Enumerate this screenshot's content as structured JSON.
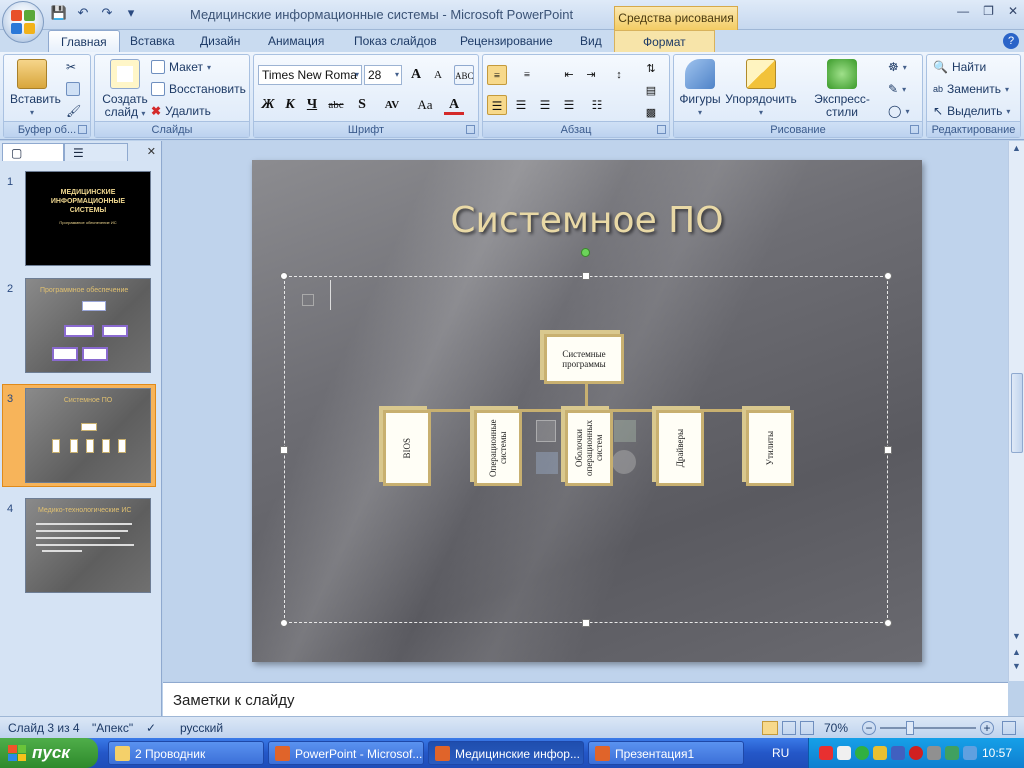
{
  "window": {
    "title": "Медицинские информационные системы - Microsoft PowerPoint",
    "context_tab": "Средства рисования"
  },
  "tabs": [
    "Главная",
    "Вставка",
    "Дизайн",
    "Анимация",
    "Показ слайдов",
    "Рецензирование",
    "Вид",
    "Формат"
  ],
  "ribbon": {
    "clipboard": {
      "paste": "Вставить",
      "label": "Буфер об..."
    },
    "slides": {
      "new_slide_1": "Создать",
      "new_slide_2": "слайд",
      "layout": "Макет",
      "reset": "Восстановить",
      "delete": "Удалить",
      "label": "Слайды"
    },
    "font": {
      "name": "Times New Roma",
      "size": "28",
      "label": "Шрифт",
      "bold": "Ж",
      "italic": "К",
      "underline": "Ч",
      "strike": "abc",
      "shadow": "S",
      "spacing": "AV",
      "case": "Aa",
      "color": "A",
      "grow": "A",
      "shrink": "A"
    },
    "paragraph": {
      "label": "Абзац"
    },
    "drawing": {
      "shapes": "Фигуры",
      "arrange": "Упорядочить",
      "quick_styles": "Экспресс-стили",
      "label": "Рисование"
    },
    "editing": {
      "find": "Найти",
      "replace": "Заменить",
      "select": "Выделить",
      "label": "Редактирование"
    }
  },
  "thumbnails": [
    {
      "num": "1",
      "title": "МЕДИЦИНСКИЕ ИНФОРМАЦИОННЫЕ СИСТЕМЫ",
      "sub": "Программное обеспечение ИС"
    },
    {
      "num": "2",
      "title": "Программное обеспечение"
    },
    {
      "num": "3",
      "title": "Системное ПО"
    },
    {
      "num": "4",
      "title": "Медико-технологические ИС"
    }
  ],
  "slide": {
    "title": "Системное ПО",
    "root": "Системные программы",
    "children": [
      "BIOS",
      "Операционные системы",
      "Оболочки операционных систем",
      "Драйверы",
      "Утилиты"
    ]
  },
  "notes": "Заметки к слайду",
  "status": {
    "slide": "Слайд 3 из 4",
    "theme": "\"Апекс\"",
    "lang": "русский",
    "zoom": "70%"
  },
  "taskbar": {
    "start": "пуск",
    "tasks": [
      "2 Проводник",
      "PowerPoint - Microsof...",
      "Медицинские инфор...",
      "Презентация1"
    ],
    "lang": "RU",
    "clock": "10:57"
  },
  "colors": {
    "accent": "#e9d9a6",
    "node_border": "#c8b070",
    "taskbar": "#2457c8"
  }
}
